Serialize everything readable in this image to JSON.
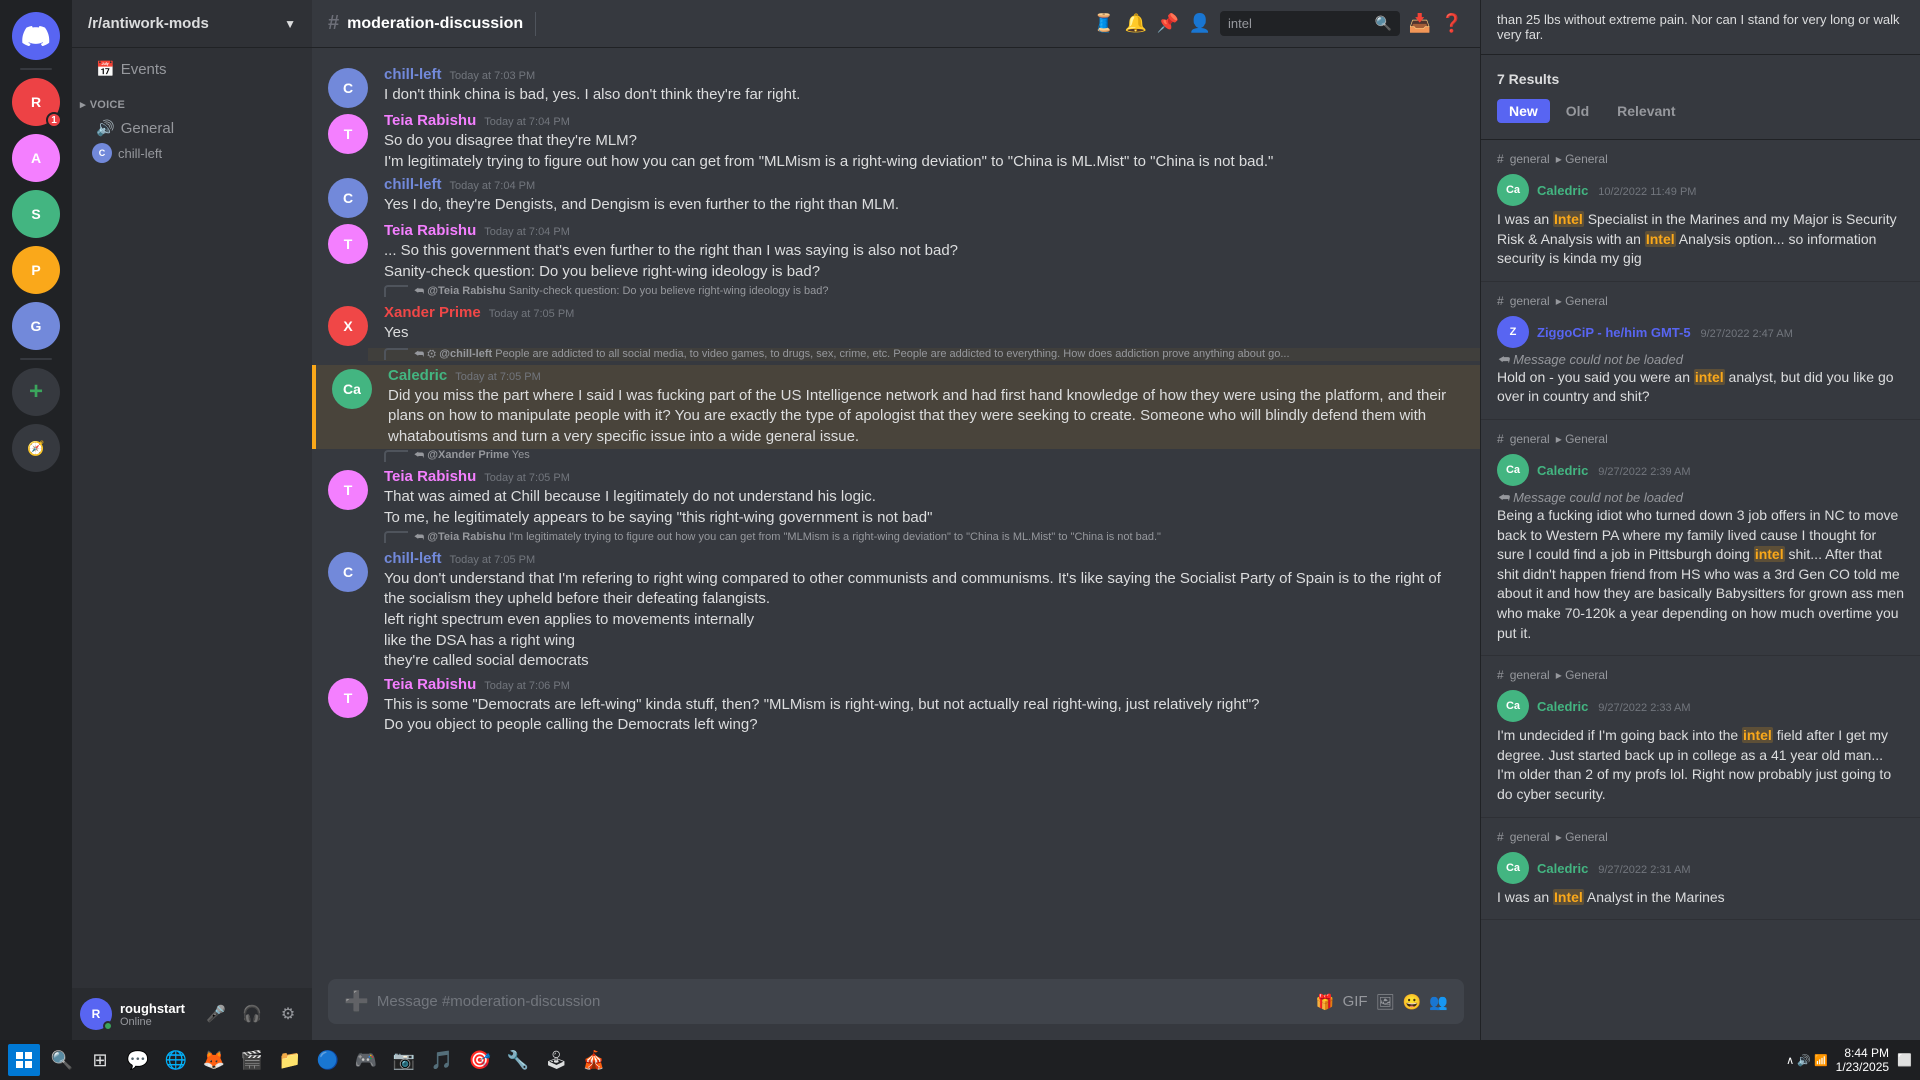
{
  "app": {
    "title": "Discord",
    "taskbar_time": "8:44 PM",
    "taskbar_date": "1/23/2025"
  },
  "server": {
    "name": "/r/antiwork-mods",
    "channel": "moderation-discussion"
  },
  "sidebar": {
    "categories": [
      {
        "name": "VOICE",
        "items": [
          {
            "name": "General",
            "type": "voice"
          },
          {
            "name": "chill-left",
            "type": "voice-sub"
          }
        ]
      }
    ]
  },
  "user": {
    "name": "roughstart",
    "tag": "Online"
  },
  "messages": [
    {
      "id": 1,
      "author": "chill-left",
      "color": "#7289da",
      "avatar_bg": "#7289da",
      "avatar_letter": "C",
      "timestamp": "Today at 7:03 PM",
      "text": "I don't think china is bad, yes. I also don't think they're far right."
    },
    {
      "id": 2,
      "author": "Teia Rabishu",
      "color": "#f47fff",
      "avatar_bg": "#f47fff",
      "avatar_letter": "T",
      "timestamp": "Today at 7:04 PM",
      "lines": [
        "So do you disagree that they're MLM?",
        "I'm legitimately trying to figure out how you can get from \"MLMism is a right-wing deviation\" to \"China is ML.Mist\" to \"China is not bad.\""
      ]
    },
    {
      "id": 3,
      "author": "chill-left",
      "color": "#7289da",
      "avatar_bg": "#7289da",
      "avatar_letter": "C",
      "timestamp": "Today at 7:04 PM",
      "text": "Yes I do, they're Dengists, and Dengism is even further to the right than MLM."
    },
    {
      "id": 4,
      "author": "Teia Rabishu",
      "color": "#f47fff",
      "avatar_bg": "#f47fff",
      "avatar_letter": "T",
      "timestamp": "Today at 7:04 PM",
      "lines": [
        "... So this government that's even further to the right than I was saying is also not bad?",
        "Sanity-check question: Do you believe right-wing ideology is bad?"
      ]
    },
    {
      "id": 5,
      "author": "Xander Prime",
      "color": "#f04747",
      "avatar_bg": "#f04747",
      "avatar_letter": "X",
      "timestamp": "Today at 7:05 PM",
      "reply_to": "@Teia Rabishu Sanity-check question: Do you believe right-wing ideology is bad?",
      "text": "Yes"
    },
    {
      "id": 6,
      "author": "Caledric",
      "color": "#43b581",
      "avatar_bg": "#43b581",
      "avatar_letter": "Ca",
      "timestamp": "Today at 7:05 PM",
      "reply_to": "@chill-left People are addicted to all social media, to video games, to drugs, sex, crime, etc. People are addicted to everything. How does addiction prove anything about go...",
      "highlighted": true,
      "lines": [
        "Did you miss the part where I said I was fucking part of the US Intelligence network and had first hand knowledge of how they were using the platform, and their plans on how to manipulate people with it?  You are exactly the type of apologist that they were seeking to create.  Someone who will blindly defend them with whataboutisms and turn a very specific issue into a wide general issue."
      ]
    },
    {
      "id": 7,
      "author": "Teia Rabishu",
      "color": "#f47fff",
      "avatar_bg": "#f47fff",
      "avatar_letter": "T",
      "timestamp": "Today at 7:05 PM",
      "reply_to": "@Xander Prime Yes",
      "lines": [
        "That was aimed at Chill because I legitimately do not understand his logic.",
        "To me, he legitimately appears to be saying \"this right-wing government is not bad\""
      ]
    },
    {
      "id": 8,
      "author": "chill-left",
      "color": "#7289da",
      "avatar_bg": "#7289da",
      "avatar_letter": "C",
      "timestamp": "Today at 7:05 PM",
      "reply_to": "@Teia Rabishu I'm legitimately trying to figure out how you can get from \"MLMism is a right-wing deviation\" to \"China is ML.Mist\" to \"China is not bad.\"",
      "lines": [
        "You don't understand that I'm refering to right wing compared to other communists and communisms. It's like saying the Socialist Party of Spain is to the right of the socialism they upheld before their defeating falangists.",
        "left right spectrum even applies to movements internally",
        "like the DSA has a right wing",
        "they're called social democrats"
      ]
    },
    {
      "id": 9,
      "author": "Teia Rabishu",
      "color": "#f47fff",
      "avatar_bg": "#f47fff",
      "avatar_letter": "T",
      "timestamp": "Today at 7:06 PM",
      "lines": [
        "This is some \"Democrats are left-wing\" kinda stuff, then?  \"MLMism is right-wing, but not actually real right-wing, just relatively right\"?",
        "Do you object to people calling the Democrats left wing?"
      ]
    }
  ],
  "search": {
    "query": "intel",
    "results_count": "7 Results",
    "filter_buttons": [
      "New",
      "Old",
      "Relevant"
    ],
    "active_filter": "New",
    "results": [
      {
        "id": 1,
        "channel": "general",
        "channel_label": "General",
        "author": "Caledric",
        "author_color": "#43b581",
        "avatar_letter": "Ca",
        "timestamp": "10/2/2022 11:49 PM",
        "text_before": "I was an ",
        "highlight": "Intel",
        "text_after": " Specialist in the Marines and my Major is Security Risk & Analysis with an ",
        "highlight2": "Intel",
        "text_after2": " Analysis option... so information security is kinda my gig"
      },
      {
        "id": 2,
        "channel": "general",
        "channel_label": "General",
        "author": "ZiggoCiP - he/him GMT-5",
        "author_color": "#5865f2",
        "avatar_letter": "Z",
        "timestamp": "9/27/2022 2:47 AM",
        "could_not_load": true,
        "text": "Hold on - you said you were an intel analyst, but did you like go over in country and shit?"
      },
      {
        "id": 3,
        "channel": "general",
        "channel_label": "General",
        "author": "Caledric",
        "author_color": "#43b581",
        "avatar_letter": "Ca",
        "timestamp": "9/27/2022 2:39 AM",
        "could_not_load": true,
        "text": "Being a fucking idiot who turned down 3 job offers in NC to move back to Western PA where my family lived cause I thought for sure I could find a job in Pittsburgh doing intel shit...  After that shit didn't happen friend from HS who was a 3rd Gen CO told me about it and how they are basically Babysitters for grown ass men who make 70-120k a year depending on how much overtime you put it."
      },
      {
        "id": 4,
        "channel": "general",
        "channel_label": "General",
        "author": "Caledric",
        "author_color": "#43b581",
        "avatar_letter": "Ca",
        "timestamp": "9/27/2022 2:33 AM",
        "text": "I'm undecided if I'm going back into the intel field after I get my degree.  Just started back up in college as a 41 year old man... I'm older than 2 of my profs lol. Right now probably just going to do cyber security."
      },
      {
        "id": 5,
        "channel": "general",
        "channel_label": "General",
        "author": "Caledric",
        "author_color": "#43b581",
        "avatar_letter": "Ca",
        "timestamp": "9/27/2022 2:31 AM",
        "text": "I was an Intel Analyst in the Marines"
      }
    ]
  },
  "input_placeholder": "Message #moderation-discussion",
  "server_icons": [
    {
      "letter": "D",
      "bg": "#5865f2",
      "type": "home"
    },
    {
      "letter": "R",
      "bg": "#ed4245",
      "badge": "1"
    },
    {
      "letter": "A",
      "bg": "#f47fff"
    },
    {
      "letter": "S",
      "bg": "#43b581"
    },
    {
      "letter": "P",
      "bg": "#faa81a"
    },
    {
      "letter": "G",
      "bg": "#7289da"
    }
  ]
}
